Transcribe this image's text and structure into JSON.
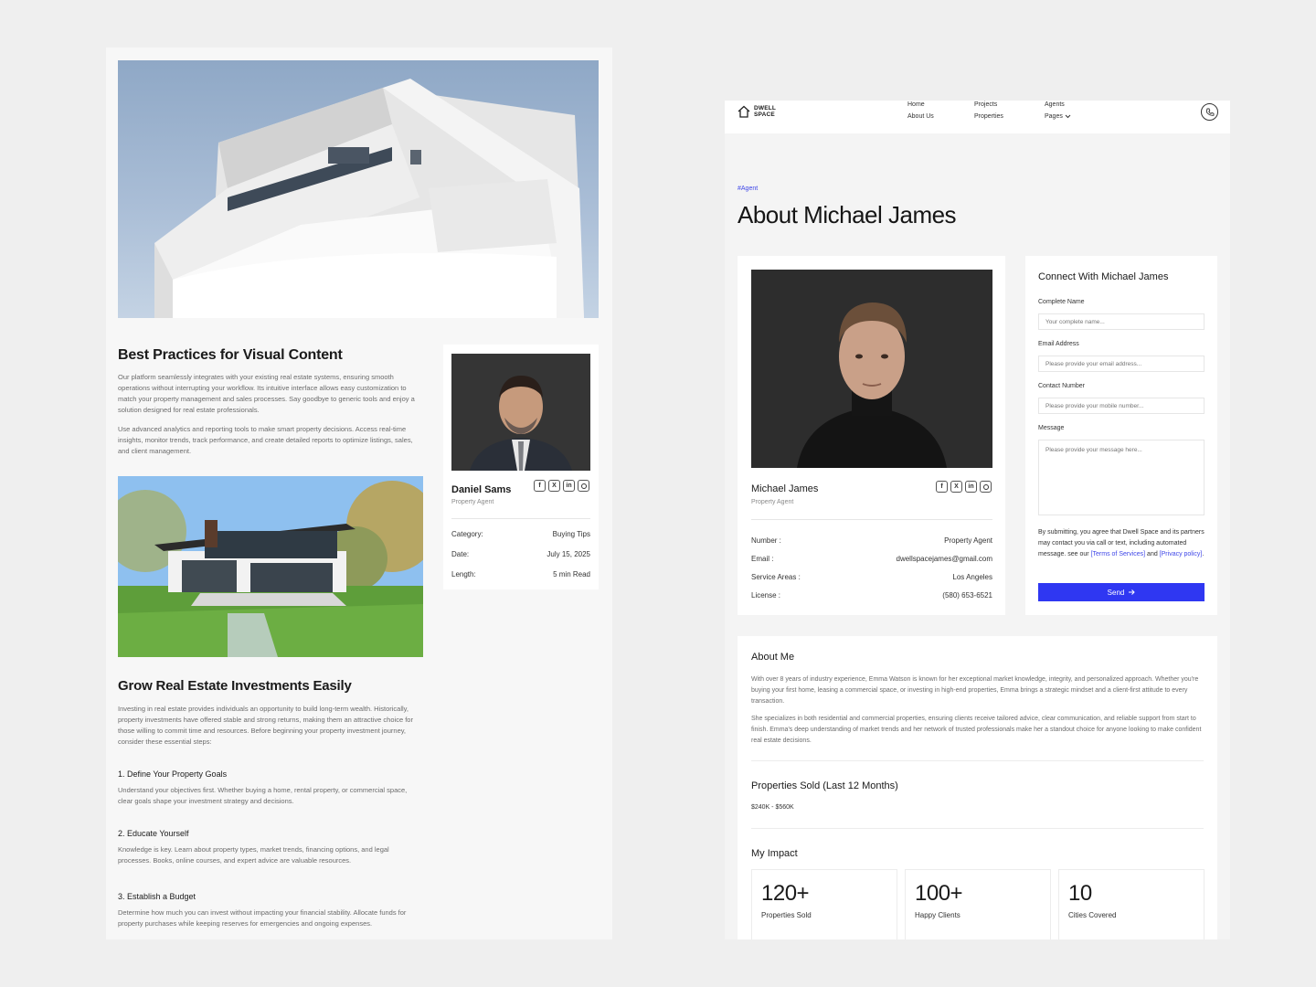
{
  "blog": {
    "title": "Best Practices for Visual Content",
    "para1": "Our platform seamlessly integrates with your existing real estate systems, ensuring smooth operations without interrupting your workflow. Its intuitive interface allows easy customization to match your property management and sales processes. Say goodbye to generic tools and enjoy a solution designed for real estate professionals.",
    "para2": "Use advanced analytics and reporting tools to make smart property decisions. Access real-time insights, monitor trends, track performance, and create detailed reports to optimize listings, sales, and client management.",
    "title2": "Grow Real Estate Investments Easily",
    "para3": "Investing in real estate provides individuals an opportunity to build long-term wealth. Historically, property investments have offered stable and strong returns, making them an attractive choice for those willing to commit time and resources. Before beginning your property investment journey, consider these essential steps:",
    "steps": [
      {
        "title": "1. Define Your Property Goals",
        "text": "Understand your objectives first. Whether buying a home, rental property, or commercial space, clear goals shape your investment strategy and decisions."
      },
      {
        "title": "2. Educate Yourself",
        "text": "Knowledge is key. Learn about property types, market trends, financing options, and legal processes. Books, online courses, and expert advice are valuable resources."
      },
      {
        "title": "3. Establish a Budget",
        "text": "Determine how much you can invest without impacting your financial stability. Allocate funds for property purchases while keeping reserves for emergencies and ongoing expenses."
      }
    ],
    "author": {
      "name": "Daniel Sams",
      "role": "Property Agent",
      "meta": [
        {
          "label": "Category:",
          "value": "Buying Tips"
        },
        {
          "label": "Date:",
          "value": "July 15, 2025"
        },
        {
          "label": "Length:",
          "value": "5 min Read"
        }
      ]
    }
  },
  "site": {
    "logo_line1": "DWELL",
    "logo_line2": "SPACE",
    "nav": {
      "home": "Home",
      "about": "About Us",
      "projects": "Projects",
      "properties": "Properties",
      "agents": "Agents",
      "pages": "Pages"
    }
  },
  "agent_page": {
    "tag": "#Agent",
    "title": "About Michael James",
    "agent": {
      "name": "Michael James",
      "role": "Property Agent",
      "details": [
        {
          "label": "Number :",
          "value": "Property Agent"
        },
        {
          "label": "Email :",
          "value": "dwellspacejames@gmail.com"
        },
        {
          "label": "Service Areas :",
          "value": "Los Angeles"
        },
        {
          "label": "License :",
          "value": "(580) 653-6521"
        }
      ]
    },
    "form": {
      "title": "Connect With Michael James",
      "name_label": "Complete Name",
      "name_placeholder": "Your complete name...",
      "email_label": "Email Address",
      "email_placeholder": "Please provide your email address...",
      "phone_label": "Contact Number",
      "phone_placeholder": "Please provide your mobile number...",
      "message_label": "Message",
      "message_placeholder": "Please provide your message here...",
      "note_before": "By submitting, you agree that Dwell Space and its partners may contact you via call or text, including automated message. see our ",
      "terms": "[Terms of Services]",
      "and": " and ",
      "privacy": "[Privacy policy]",
      "period": ".",
      "send": "Send"
    },
    "about": {
      "title": "About Me",
      "para1": "With over 8 years of industry experience, Emma Watson is known for her exceptional market knowledge, integrity, and personalized approach. Whether you're buying your first home, leasing a commercial space, or investing in high-end properties, Emma brings a strategic mindset and a client-first attitude to every transaction.",
      "para2": "She specializes in both residential and commercial properties, ensuring clients receive tailored advice, clear communication, and reliable support from start to finish. Emma's deep understanding of market trends and her network of trusted professionals make her a standout choice for anyone looking to make confident real estate decisions.",
      "sold_title": "Properties Sold (Last 12 Months)",
      "sold_range": "$240K - $560K",
      "impact_title": "My Impact",
      "stats": [
        {
          "num": "120+",
          "label": "Properties Sold"
        },
        {
          "num": "100+",
          "label": "Happy Clients"
        },
        {
          "num": "10",
          "label": "Cities Covered"
        }
      ]
    }
  },
  "colors": {
    "accent": "#2f37f2",
    "link": "#3f47e8",
    "background": "#efefef"
  }
}
